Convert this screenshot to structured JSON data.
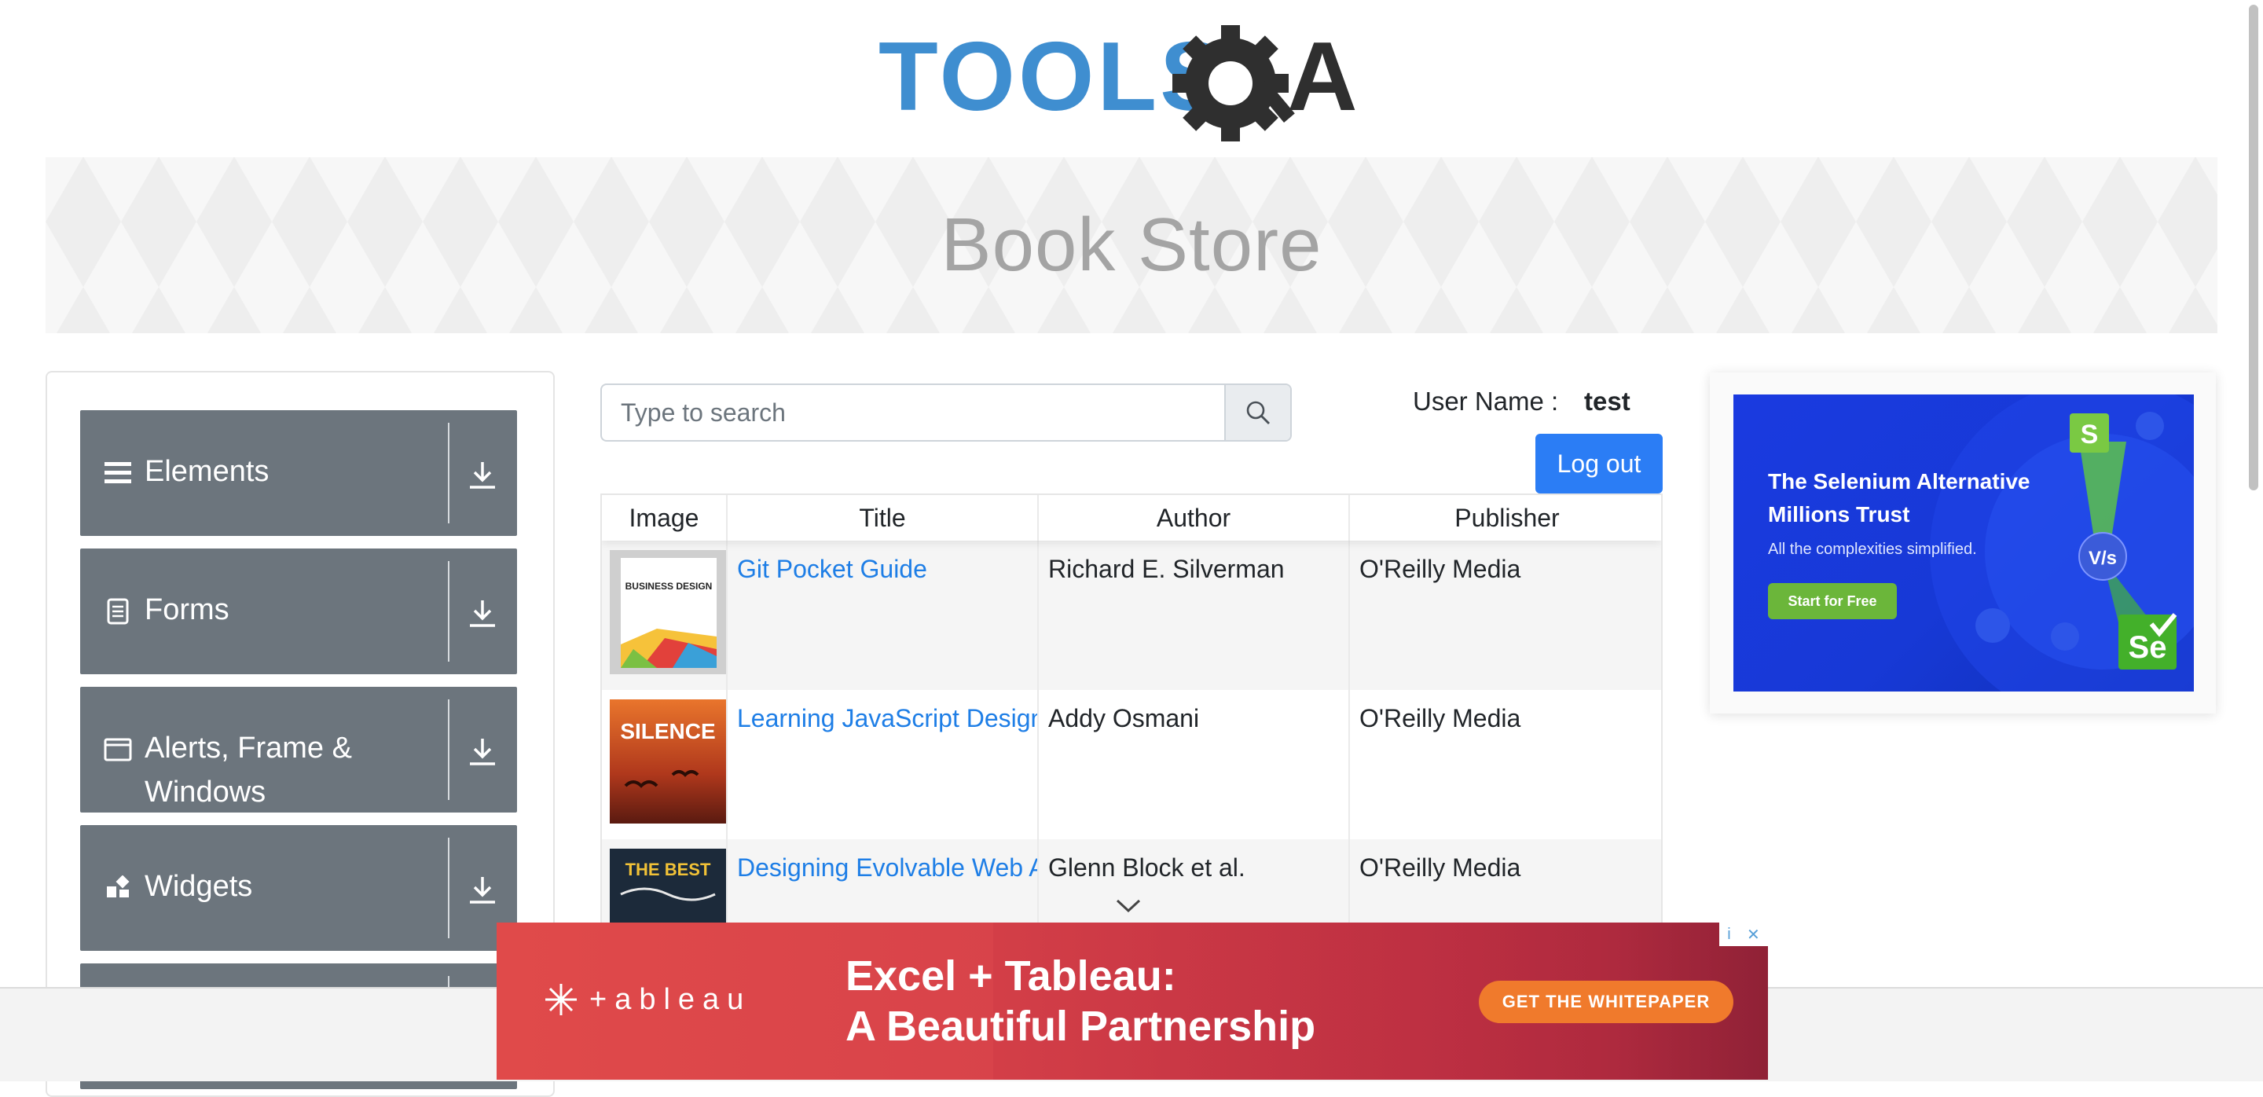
{
  "header": {
    "logo_text_left": "TOOLS",
    "logo_text_right": "A"
  },
  "banner": {
    "title": "Book Store"
  },
  "sidebar": {
    "groups": [
      {
        "label": "Elements",
        "icon": "hamburger-icon"
      },
      {
        "label": "Forms",
        "icon": "document-icon"
      },
      {
        "label": "Alerts, Frame & Windows",
        "icon": "window-icon"
      },
      {
        "label": "Widgets",
        "icon": "widgets-icon"
      }
    ]
  },
  "search": {
    "placeholder": "Type to search",
    "value": ""
  },
  "user": {
    "label": "User Name :",
    "value": "test",
    "logout_label": "Log out"
  },
  "table": {
    "headers": [
      "Image",
      "Title",
      "Author",
      "Publisher"
    ],
    "rows": [
      {
        "title": "Git Pocket Guide",
        "author": "Richard E. Silverman",
        "publisher": "O'Reilly Media",
        "cover_text": "BUSINESS DESIGN"
      },
      {
        "title": "Learning JavaScript Design Patterns",
        "author": "Addy Osmani",
        "publisher": "O'Reilly Media",
        "cover_text": "SILENCE"
      },
      {
        "title": "Designing Evolvable Web APIs with ASP.NET",
        "author": "Glenn Block et al.",
        "publisher": "O'Reilly Media",
        "cover_text": "THE BEST"
      }
    ]
  },
  "right_ad": {
    "headline": "The Selenium Alternative Millions Trust",
    "subtext": "All the complexities simplified.",
    "button": "Start for Free",
    "badge_s": "S",
    "badge_vs": "V/s",
    "badge_se": "Se"
  },
  "bottom_ad": {
    "brand": "+ableau",
    "headline_line1": "Excel + Tableau:",
    "headline_line2": "A Beautiful Partnership",
    "button": "GET THE WHITEPAPER",
    "info_glyph": "i",
    "close_glyph": "✕"
  },
  "colors": {
    "accent_blue": "#2b7df5",
    "link_blue": "#1e7ee6",
    "sidebar_gray": "#6c757d",
    "tableau_red": "#d8434a",
    "selenium_blue": "#1739d6"
  }
}
